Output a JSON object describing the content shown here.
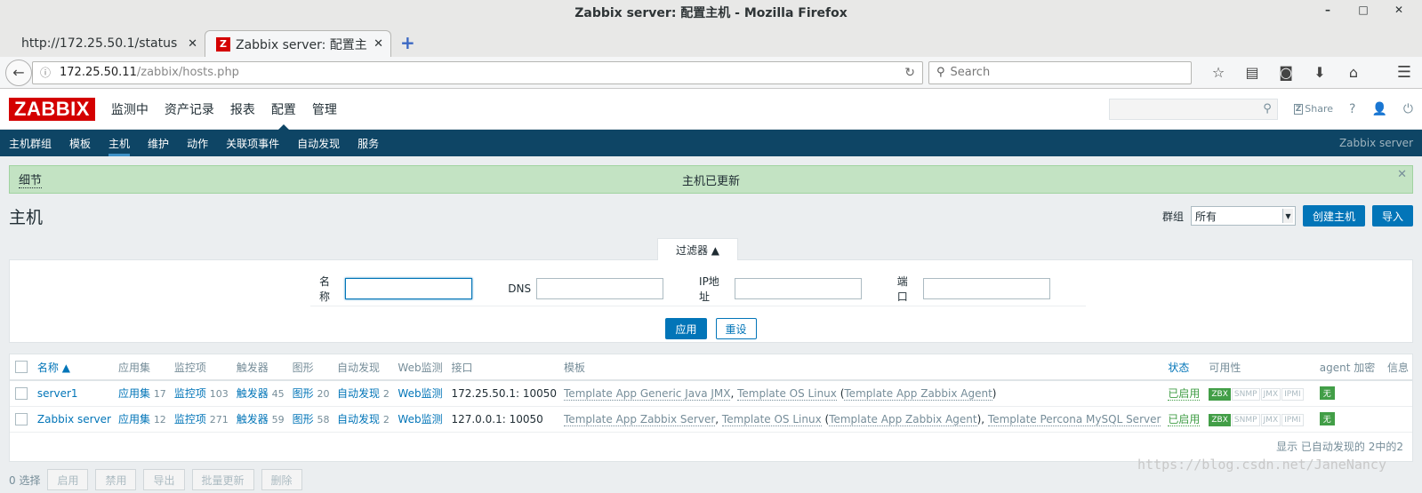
{
  "window": {
    "title": "Zabbix server: 配置主机 - Mozilla Firefox",
    "min": "–",
    "max": "□",
    "close": "✕"
  },
  "tabs": [
    {
      "label": "http://172.25.50.1/status",
      "close": "✕"
    },
    {
      "label": "Zabbix server: 配置主...",
      "close": "✕",
      "favicon": "Z"
    }
  ],
  "newtab": "+",
  "urlbar": {
    "host": "172.25.50.11",
    "path": "/zabbix/hosts.php"
  },
  "search": {
    "placeholder": "Search"
  },
  "logo": "ZABBIX",
  "topmenu": [
    "监测中",
    "资产记录",
    "报表",
    "配置",
    "管理"
  ],
  "header": {
    "share": "Share",
    "help": "?"
  },
  "submenu": [
    "主机群组",
    "模板",
    "主机",
    "维护",
    "动作",
    "关联项事件",
    "自动发现",
    "服务"
  ],
  "server_name": "Zabbix server",
  "message": {
    "details": "细节",
    "text": "主机已更新"
  },
  "page_title": "主机",
  "controls": {
    "group_label": "群组",
    "group_value": "所有",
    "create": "创建主机",
    "import": "导入"
  },
  "filter": {
    "tab": "过滤器 ▲",
    "name_label": "名称",
    "dns_label": "DNS",
    "ip_label": "IP地址",
    "port_label": "端口",
    "apply": "应用",
    "reset": "重设"
  },
  "table": {
    "headers": [
      "名称 ▲",
      "应用集",
      "监控项",
      "触发器",
      "图形",
      "自动发现",
      "Web监测",
      "接口",
      "模板",
      "状态",
      "可用性",
      "agent 加密",
      "信息"
    ],
    "rows": [
      {
        "name": "server1",
        "apps": "应用集",
        "apps_n": "17",
        "items": "监控项",
        "items_n": "103",
        "triggers": "触发器",
        "triggers_n": "45",
        "graphs": "图形",
        "graphs_n": "20",
        "discovery": "自动发现",
        "discovery_n": "2",
        "web": "Web监测",
        "interface": "172.25.50.1: 10050",
        "tpl1": "Template App Generic Java JMX",
        "tpl2": "Template OS Linux",
        "tpl3": "Template App Zabbix Agent",
        "tpl4": "",
        "status": "已启用",
        "zbx": "ZBX",
        "snmp": "SNMP",
        "jmx": "JMX",
        "ipmi": "IPMI",
        "enc": "无"
      },
      {
        "name": "Zabbix server",
        "apps": "应用集",
        "apps_n": "12",
        "items": "监控项",
        "items_n": "271",
        "triggers": "触发器",
        "triggers_n": "59",
        "graphs": "图形",
        "graphs_n": "58",
        "discovery": "自动发现",
        "discovery_n": "2",
        "web": "Web监测",
        "interface": "127.0.0.1: 10050",
        "tpl1": "Template App Zabbix Server",
        "tpl2": "Template OS Linux",
        "tpl3": "Template App Zabbix Agent",
        "tpl4": "Template Percona MySQL Server",
        "status": "已启用",
        "zbx": "ZBX",
        "snmp": "SNMP",
        "jmx": "JMX",
        "ipmi": "IPMI",
        "enc": "无"
      }
    ],
    "footer": "显示 已自动发现的 2中的2"
  },
  "bottom": {
    "selected": "0 选择",
    "enable": "启用",
    "disable": "禁用",
    "export": "导出",
    "mass_update": "批量更新",
    "delete": "删除"
  },
  "watermark": "https://blog.csdn.net/JaneNancy"
}
